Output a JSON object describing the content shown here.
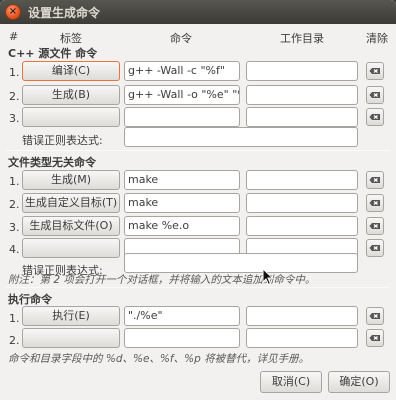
{
  "window": {
    "title": "设置生成命令"
  },
  "columns": {
    "num": "#",
    "label": "标签",
    "command": "命令",
    "workdir": "工作目录",
    "clear": "清除"
  },
  "sections": {
    "filetype": {
      "title": "C++ 源文件 命令",
      "rows": [
        {
          "num": "1.",
          "label": "编译(C)",
          "command": "g++ -Wall -c \"%f\"",
          "workdir": ""
        },
        {
          "num": "2.",
          "label": "生成(B)",
          "command": "g++ -Wall -o \"%e\" \"%f\"",
          "workdir": ""
        },
        {
          "num": "3.",
          "label": "",
          "command": "",
          "workdir": ""
        }
      ],
      "regex_label": "错误正则表达式:",
      "regex_value": ""
    },
    "independent": {
      "title": "文件类型无关命令",
      "rows": [
        {
          "num": "1.",
          "label": "生成(M)",
          "command": "make",
          "workdir": ""
        },
        {
          "num": "2.",
          "label": "生成自定义目标(T)",
          "command": "make",
          "workdir": ""
        },
        {
          "num": "3.",
          "label": "生成目标文件(O)",
          "command": "make %e.o",
          "workdir": ""
        },
        {
          "num": "4.",
          "label": "",
          "command": "",
          "workdir": ""
        }
      ],
      "regex_label": "错误正则表达式:",
      "regex_value": "",
      "note": "附注：第 2 项会打开一个对话框，并将输入的文本追加到命令中。"
    },
    "execute": {
      "title": "执行命令",
      "rows": [
        {
          "num": "1.",
          "label": "执行(E)",
          "command": "\"./%e\"",
          "workdir": ""
        },
        {
          "num": "2.",
          "label": "",
          "command": "",
          "workdir": ""
        }
      ]
    }
  },
  "footer_note": "命令和目录字段中的 %d、%e、%f、%p 将被替代，详见手册。",
  "buttons": {
    "cancel": "取消(C)",
    "ok": "确定(O)"
  },
  "icons": {
    "close": "close-icon",
    "clear": "clear-text-icon",
    "cursor": "mouse-pointer-icon"
  },
  "colors": {
    "titlebar": "#3c3b37",
    "close_button": "#e5521f",
    "focus_border": "#e8743b",
    "background": "#f2f1f0"
  }
}
